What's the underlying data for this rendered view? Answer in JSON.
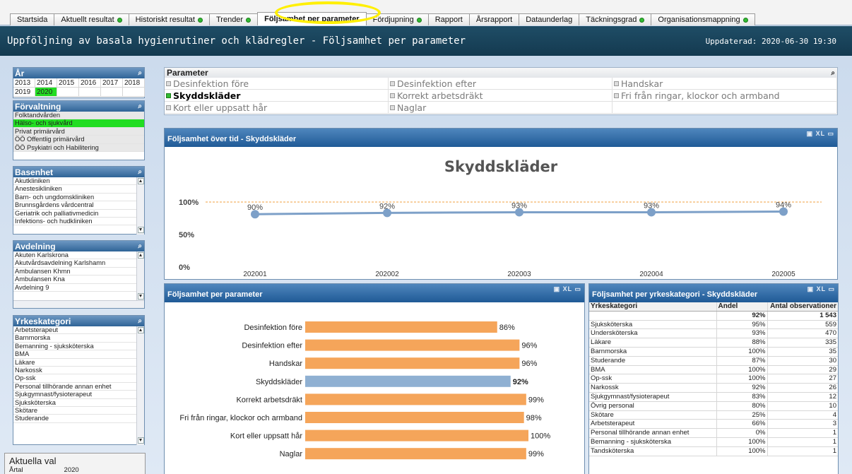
{
  "tabs": [
    {
      "label": "Startsida",
      "dot": false
    },
    {
      "label": "Aktuellt resultat",
      "dot": true
    },
    {
      "label": "Historiskt resultat",
      "dot": true
    },
    {
      "label": "Trender",
      "dot": true
    },
    {
      "label": "Följsamhet per parameter",
      "dot": false,
      "active": true
    },
    {
      "label": "Fördjupning",
      "dot": true
    },
    {
      "label": "Rapport",
      "dot": false
    },
    {
      "label": "Årsrapport",
      "dot": false
    },
    {
      "label": "Dataunderlag",
      "dot": false
    },
    {
      "label": "Täckningsgrad",
      "dot": true
    },
    {
      "label": "Organisationsmappning",
      "dot": true
    }
  ],
  "header": {
    "title": "Uppföljning av basala hygienrutiner och klädregler - Följsamhet per parameter",
    "updated": "Uppdaterad: 2020-06-30 19:30"
  },
  "sidebar": {
    "year": {
      "title": "År",
      "years": [
        "2013",
        "2014",
        "2015",
        "2016",
        "2017",
        "2018",
        "2019",
        "2020"
      ],
      "selected": "2020"
    },
    "forvaltning": {
      "title": "Förvaltning",
      "items": [
        "Folktandvården",
        "Hälso- och sjukvård",
        "Privat primärvård",
        "ÖÖ Offentlig primärvård",
        "ÖÖ Psykiatri och Habilitering"
      ],
      "selected": "Hälso- och sjukvård"
    },
    "basenhet": {
      "title": "Basenhet",
      "items": [
        "Akutkliniken",
        "Anestesikliniken",
        "Barn- och ungdomskliniken",
        "Brunnsgårdens vårdcentral",
        "Geriatrik och palliativmedicin",
        "Infektions- och hudkliniken"
      ]
    },
    "avdelning": {
      "title": "Avdelning",
      "items": [
        "Akuten Karlskrona",
        "Akutvårdsavdelning Karlshamn",
        "Ambulansen Khmn",
        "Ambulansen Kna",
        "Avdelning 9"
      ]
    },
    "yrkeskategori": {
      "title": "Yrkeskategori",
      "items": [
        "Arbetsterapeut",
        "Barnmorska",
        "Bemanning - sjuksköterska",
        "BMA",
        "Läkare",
        "Narkossk",
        "Op-ssk",
        "Personal tillhörande annan enhet",
        "Sjukgymnast/fysioterapeut",
        "Sjuksköterska",
        "Skötare",
        "Studerande"
      ]
    },
    "aktuella_val": {
      "title": "Aktuella val",
      "field": "Årtal",
      "value": "2020"
    }
  },
  "parameter": {
    "title": "Parameter",
    "items": [
      {
        "label": "Desinfektion före",
        "selected": false
      },
      {
        "label": "Desinfektion efter",
        "selected": false
      },
      {
        "label": "Handskar",
        "selected": false
      },
      {
        "label": "Skyddskläder",
        "selected": true
      },
      {
        "label": "Korrekt arbetsdräkt",
        "selected": false
      },
      {
        "label": "Fri från ringar, klockor och armband",
        "selected": false
      },
      {
        "label": "Kort eller uppsatt hår",
        "selected": false
      },
      {
        "label": "Naglar",
        "selected": false
      },
      {
        "label": "",
        "selected": false
      }
    ]
  },
  "line_panel": {
    "title": "Följsamhet över tid - Skyddskläder",
    "icons": "▣ XL ▭"
  },
  "bar_panel": {
    "title": "Följsamhet per parameter",
    "icons": "▣ XL ▭"
  },
  "table_panel": {
    "title": "Följsamhet per yrkeskategori - Skyddskläder",
    "icons": "▣ XL ▭",
    "headers": [
      "Yrkeskategori",
      "Andel",
      "Antal observationer"
    ],
    "total": {
      "andel": "92%",
      "antal": "1 543"
    },
    "rows": [
      [
        "Sjuksköterska",
        "95%",
        "559"
      ],
      [
        "Undersköterska",
        "93%",
        "470"
      ],
      [
        "Läkare",
        "88%",
        "335"
      ],
      [
        "Barnmorska",
        "100%",
        "35"
      ],
      [
        "Studerande",
        "87%",
        "30"
      ],
      [
        "BMA",
        "100%",
        "29"
      ],
      [
        "Op-ssk",
        "100%",
        "27"
      ],
      [
        "Narkossk",
        "92%",
        "26"
      ],
      [
        "Sjukgymnast/fysioterapeut",
        "83%",
        "12"
      ],
      [
        "Övrig personal",
        "80%",
        "10"
      ],
      [
        "Skötare",
        "25%",
        "4"
      ],
      [
        "Arbetsterapeut",
        "66%",
        "3"
      ],
      [
        "Personal tillhörande annan enhet",
        "0%",
        "1"
      ],
      [
        "Bemanning - sjuksköterska",
        "100%",
        "1"
      ],
      [
        "Tandsköterska",
        "100%",
        "1"
      ]
    ]
  },
  "colors": {
    "accent_green": "#22dd22",
    "bar_orange": "#f5a55a",
    "bar_blue": "#8fb0d2",
    "line_blue": "#7da0c8",
    "ref_orange": "#f0a040"
  },
  "chart_data": [
    {
      "type": "line",
      "title": "Skyddskläder",
      "x": [
        "202001",
        "202002",
        "202003",
        "202004",
        "202005"
      ],
      "values": [
        90,
        92,
        93,
        93,
        94
      ],
      "data_labels": [
        "90%",
        "92%",
        "93%",
        "93%",
        "94%"
      ],
      "yticks": [
        "0%",
        "50%",
        "100%"
      ],
      "ylim": [
        0,
        100
      ],
      "reference_line": 100
    },
    {
      "type": "bar",
      "orientation": "horizontal",
      "categories": [
        "Desinfektion före",
        "Desinfektion efter",
        "Handskar",
        "Skyddskläder",
        "Korrekt arbetsdräkt",
        "Fri från ringar, klockor och armband",
        "Kort eller uppsatt hår",
        "Naglar"
      ],
      "values": [
        86,
        96,
        96,
        92,
        99,
        98,
        100,
        99
      ],
      "data_labels": [
        "86%",
        "96%",
        "96%",
        "92%",
        "99%",
        "98%",
        "100%",
        "99%"
      ],
      "highlight": "Skyddskläder",
      "xlim": [
        0,
        100
      ]
    }
  ]
}
